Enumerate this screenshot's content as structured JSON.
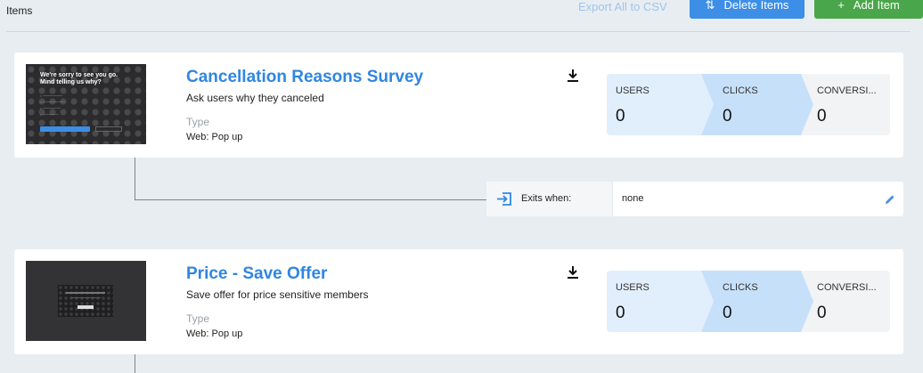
{
  "header": {
    "items_label": "Items",
    "export_label": "Export All to CSV",
    "delete_label": "Delete Items",
    "add_label": "Add Item"
  },
  "cards": [
    {
      "title": "Cancellation Reasons Survey",
      "subtitle": "Ask users why they canceled",
      "type_label": "Type",
      "type_value": "Web: Pop up",
      "thumbnail": {
        "heading_line1": "We're sorry to see you go.",
        "heading_line2": "Mind telling us why?"
      },
      "stats": [
        {
          "label": "USERS",
          "value": "0"
        },
        {
          "label": "CLICKS",
          "value": "0"
        },
        {
          "label": "CONVERSI...",
          "value": "0"
        }
      ]
    },
    {
      "title": "Price - Save Offer",
      "subtitle": "Save offer for price sensitive members",
      "type_label": "Type",
      "type_value": "Web: Pop up",
      "stats": [
        {
          "label": "USERS",
          "value": "0"
        },
        {
          "label": "CLICKS",
          "value": "0"
        },
        {
          "label": "CONVERSI...",
          "value": "0"
        }
      ]
    }
  ],
  "exit_rule": {
    "label": "Exits when:",
    "value": "none"
  },
  "colors": {
    "accent": "#2f86e0",
    "delete_button": "#3d8ee6",
    "add_button": "#4aa64a",
    "background": "#e8edf1"
  },
  "icons": {
    "delete": "sort-arrows-icon",
    "add": "plus-icon",
    "download": "download-icon",
    "exit": "exit-icon",
    "edit": "pencil-icon"
  }
}
